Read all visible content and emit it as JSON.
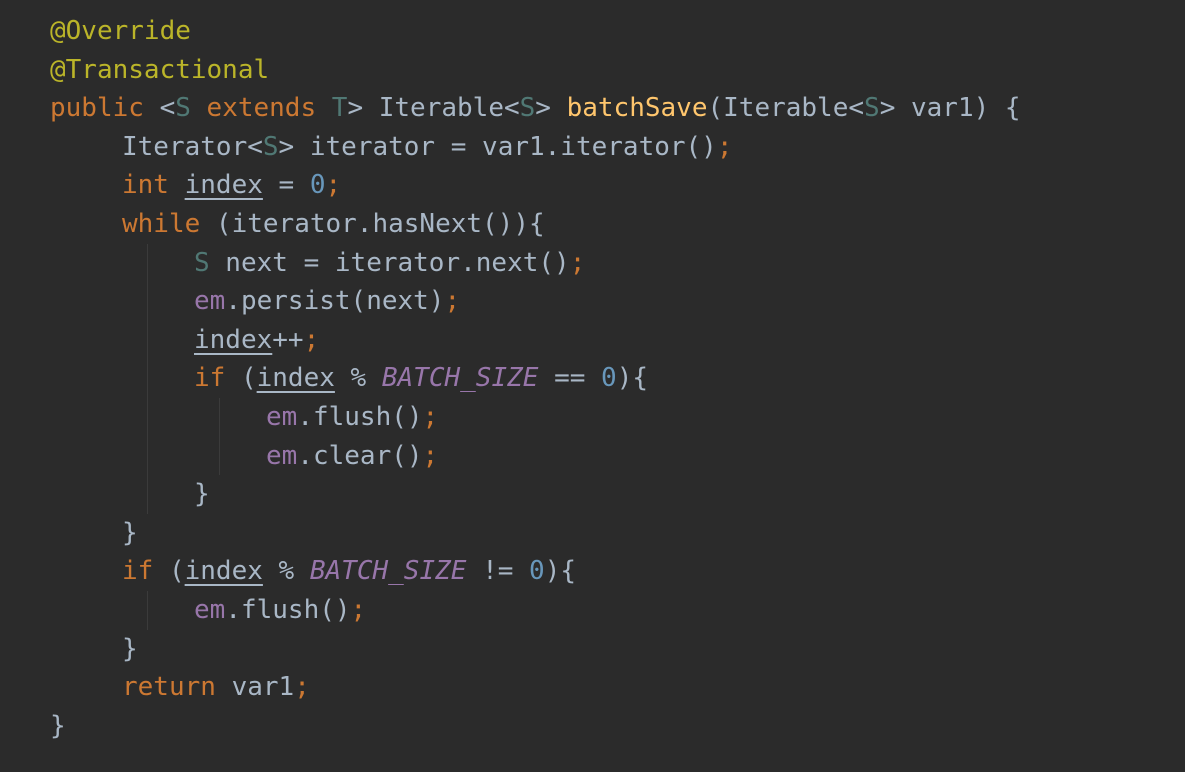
{
  "editor": {
    "theme_background": "#2b2b2b",
    "colors": {
      "annotation": "#bbb529",
      "keyword": "#cc7832",
      "type_param": "#507874",
      "method_decl": "#ffc66d",
      "number": "#6897bb",
      "field": "#9876aa",
      "text": "#a9b7c6"
    },
    "lines": [
      {
        "tokens": [
          {
            "t": "@Override",
            "c": "ann"
          }
        ]
      },
      {
        "tokens": [
          {
            "t": "@Transactional",
            "c": "ann"
          }
        ]
      },
      {
        "tokens": [
          {
            "t": "public ",
            "c": "kw"
          },
          {
            "t": "<",
            "c": "plain"
          },
          {
            "t": "S",
            "c": "tp"
          },
          {
            "t": " extends ",
            "c": "kw"
          },
          {
            "t": "T",
            "c": "tp"
          },
          {
            "t": "> Iterable<",
            "c": "plain"
          },
          {
            "t": "S",
            "c": "tp"
          },
          {
            "t": "> ",
            "c": "plain"
          },
          {
            "t": "batchSave",
            "c": "fn"
          },
          {
            "t": "(Iterable<",
            "c": "plain"
          },
          {
            "t": "S",
            "c": "tp"
          },
          {
            "t": "> var1) {",
            "c": "plain"
          }
        ]
      },
      {
        "indent": 1,
        "tokens": [
          {
            "t": "Iterator<",
            "c": "plain"
          },
          {
            "t": "S",
            "c": "tp"
          },
          {
            "t": "> iterator = var1.iterator()",
            "c": "plain"
          },
          {
            "t": ";",
            "c": "semi"
          }
        ]
      },
      {
        "indent": 1,
        "tokens": [
          {
            "t": "int ",
            "c": "kw"
          },
          {
            "t": "index",
            "c": "var"
          },
          {
            "t": " = ",
            "c": "plain"
          },
          {
            "t": "0",
            "c": "num"
          },
          {
            "t": ";",
            "c": "semi"
          }
        ]
      },
      {
        "indent": 1,
        "tokens": [
          {
            "t": "while ",
            "c": "kw"
          },
          {
            "t": "(iterator.hasNext()){",
            "c": "plain"
          }
        ]
      },
      {
        "indent": 2,
        "tokens": [
          {
            "t": "S",
            "c": "tp"
          },
          {
            "t": " next = iterator.next()",
            "c": "plain"
          },
          {
            "t": ";",
            "c": "semi"
          }
        ]
      },
      {
        "indent": 2,
        "tokens": [
          {
            "t": "em",
            "c": "fld"
          },
          {
            "t": ".persist(next)",
            "c": "plain"
          },
          {
            "t": ";",
            "c": "semi"
          }
        ]
      },
      {
        "indent": 2,
        "tokens": [
          {
            "t": "index",
            "c": "var"
          },
          {
            "t": "++",
            "c": "plain"
          },
          {
            "t": ";",
            "c": "semi"
          }
        ]
      },
      {
        "indent": 2,
        "tokens": [
          {
            "t": "if ",
            "c": "kw"
          },
          {
            "t": "(",
            "c": "plain"
          },
          {
            "t": "index",
            "c": "var"
          },
          {
            "t": " % ",
            "c": "plain"
          },
          {
            "t": "BATCH_SIZE",
            "c": "const"
          },
          {
            "t": " == ",
            "c": "plain"
          },
          {
            "t": "0",
            "c": "num"
          },
          {
            "t": "){",
            "c": "plain"
          }
        ]
      },
      {
        "indent": 3,
        "tokens": [
          {
            "t": "em",
            "c": "fld"
          },
          {
            "t": ".flush()",
            "c": "plain"
          },
          {
            "t": ";",
            "c": "semi"
          }
        ]
      },
      {
        "indent": 3,
        "tokens": [
          {
            "t": "em",
            "c": "fld"
          },
          {
            "t": ".clear()",
            "c": "plain"
          },
          {
            "t": ";",
            "c": "semi"
          }
        ]
      },
      {
        "indent": 2,
        "tokens": [
          {
            "t": "}",
            "c": "plain"
          }
        ]
      },
      {
        "indent": 1,
        "tokens": [
          {
            "t": "}",
            "c": "plain"
          }
        ]
      },
      {
        "indent": 1,
        "tokens": [
          {
            "t": "if ",
            "c": "kw"
          },
          {
            "t": "(",
            "c": "plain"
          },
          {
            "t": "index",
            "c": "var"
          },
          {
            "t": " % ",
            "c": "plain"
          },
          {
            "t": "BATCH_SIZE",
            "c": "const"
          },
          {
            "t": " != ",
            "c": "plain"
          },
          {
            "t": "0",
            "c": "num"
          },
          {
            "t": "){",
            "c": "plain"
          }
        ]
      },
      {
        "indent": 2,
        "tokens": [
          {
            "t": "em",
            "c": "fld"
          },
          {
            "t": ".flush()",
            "c": "plain"
          },
          {
            "t": ";",
            "c": "semi"
          }
        ]
      },
      {
        "indent": 1,
        "tokens": [
          {
            "t": "}",
            "c": "plain"
          }
        ]
      },
      {
        "indent": 1,
        "tokens": [
          {
            "t": "return ",
            "c": "kw"
          },
          {
            "t": "var1",
            "c": "plain"
          },
          {
            "t": ";",
            "c": "semi"
          }
        ]
      },
      {
        "tokens": [
          {
            "t": "}",
            "c": "plain"
          }
        ]
      }
    ]
  }
}
